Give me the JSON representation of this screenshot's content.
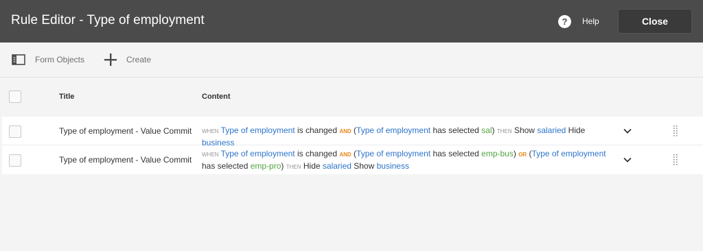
{
  "header": {
    "title": "Rule Editor - Type of employment",
    "help_label": "Help",
    "close_label": "Close"
  },
  "toolbar": {
    "form_objects_label": "Form Objects",
    "create_label": "Create"
  },
  "table": {
    "columns": {
      "title": "Title",
      "content": "Content"
    },
    "rows": [
      {
        "title": "Type of employment - Value Commit",
        "tokens": {
          "when": "WHEN",
          "obj1": "Type of employment",
          "t1": " is changed ",
          "and": "AND",
          "t2": " (",
          "obj2": "Type of employment",
          "t3": " has selected ",
          "val1": "sal",
          "t4": ") ",
          "then": "THEN",
          "t5": " Show ",
          "obj3": "salaried",
          "t6": " Hide ",
          "obj4": "business"
        }
      },
      {
        "title": "Type of employment - Value Commit",
        "tokens": {
          "when": "WHEN",
          "obj1": "Type of employment",
          "t1": " is changed ",
          "and": "AND",
          "t2": " (",
          "obj2": "Type of employment",
          "t3": " has selected ",
          "val1": "emp-bus",
          "t4": ") ",
          "or": "OR",
          "t5": " (",
          "obj3": "Type of employment",
          "t6": " has selected ",
          "val2": "emp-pro",
          "t7": ") ",
          "then": "THEN",
          "t8": " Hide ",
          "obj4": "salaried",
          "t9": " Show ",
          "obj5": "business"
        }
      }
    ]
  },
  "colors": {
    "topbar": "#4b4b4b",
    "object": "#2d74c9",
    "value": "#52a540",
    "operator": "#e68619",
    "keyword": "#959595"
  }
}
